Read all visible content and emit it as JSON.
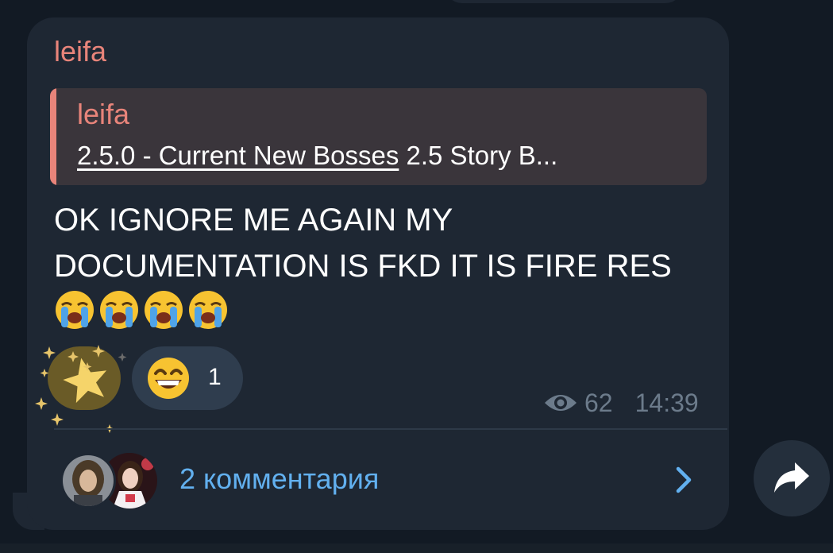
{
  "message": {
    "sender": "leifa",
    "reply": {
      "author": "leifa",
      "link_text": "2.5.0 - Current New Bosses",
      "rest_text": "  2.5 Story B..."
    },
    "text": "OK IGNORE ME AGAIN MY DOCUMENTATION IS FKD IT IS FIRE RES",
    "trailing_emoji": [
      "loudly-crying-face",
      "loudly-crying-face",
      "loudly-crying-face",
      "loudly-crying-face"
    ]
  },
  "reactions": [
    {
      "icon": "sparkling-star-icon",
      "count": ""
    },
    {
      "icon": "grinning-face-icon",
      "count": "1"
    }
  ],
  "meta": {
    "views": "62",
    "time": "14:39"
  },
  "comments": {
    "label": "2 комментария"
  },
  "colors": {
    "background": "#121a24",
    "bubble": "#1e2733",
    "sender": "#e8847a",
    "link": "#62b0ef",
    "meta": "#6c7b8b"
  }
}
